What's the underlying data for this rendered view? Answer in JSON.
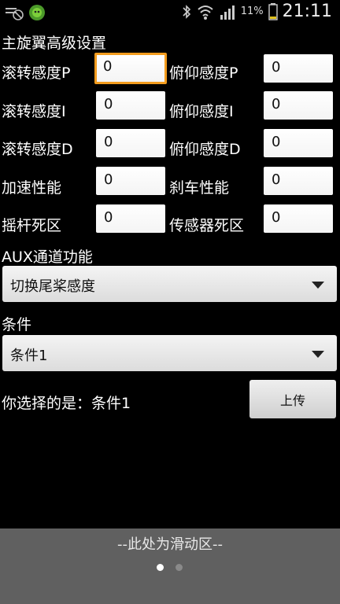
{
  "status_bar": {
    "battery_percent": "11%",
    "time": "21:11",
    "icons": [
      "no-ads-icon",
      "bug-icon",
      "bluetooth-icon",
      "wifi-icon",
      "signal-icon",
      "battery-icon"
    ]
  },
  "title": "主旋翼高级设置",
  "fields": {
    "roll_p": {
      "label": "滚转感度P",
      "value": "0"
    },
    "pitch_p": {
      "label": "俯仰感度P",
      "value": "0"
    },
    "roll_i": {
      "label": "滚转感度I",
      "value": "0"
    },
    "pitch_i": {
      "label": "俯仰感度I",
      "value": "0"
    },
    "roll_d": {
      "label": "滚转感度D",
      "value": "0"
    },
    "pitch_d": {
      "label": "俯仰感度D",
      "value": "0"
    },
    "accel": {
      "label": "加速性能",
      "value": "0"
    },
    "brake": {
      "label": "刹车性能",
      "value": "0"
    },
    "stick_deadzone": {
      "label": "摇杆死区",
      "value": "0"
    },
    "sensor_deadzone": {
      "label": "传感器死区",
      "value": "0"
    }
  },
  "aux": {
    "label": "AUX通道功能",
    "selected": "切换尾桨感度"
  },
  "condition": {
    "label": "条件",
    "selected": "条件1"
  },
  "selection_text": "你选择的是：条件1",
  "upload_label": "上传",
  "footer": {
    "text": "--此处为滑动区--",
    "page_count": 2,
    "active_page": 0
  },
  "colors": {
    "focus": "#f39c1e",
    "footer_bg": "#606060"
  }
}
